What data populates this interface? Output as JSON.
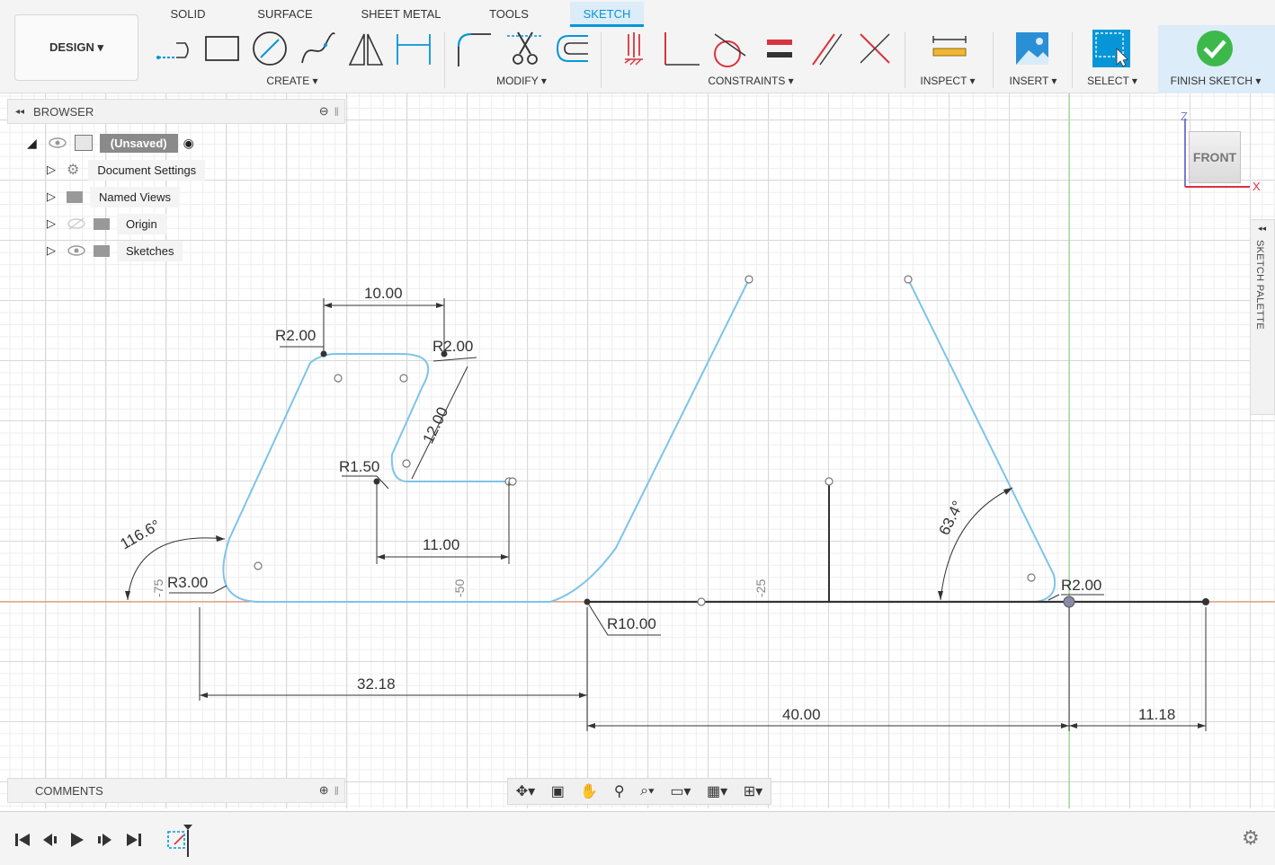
{
  "workspace": {
    "label": "DESIGN ▾"
  },
  "tabs": [
    "SOLID",
    "SURFACE",
    "SHEET METAL",
    "TOOLS",
    "SKETCH"
  ],
  "groups": {
    "create": "CREATE ▾",
    "modify": "MODIFY ▾",
    "constraints": "CONSTRAINTS ▾",
    "inspect": "INSPECT ▾",
    "insert": "INSERT ▾",
    "select": "SELECT ▾",
    "finish": "FINISH SKETCH ▾"
  },
  "colors": {
    "accent": "#0696d7",
    "profile_line": "#7ec3ea",
    "finish_check": "#3cb94a",
    "axis_red": "#e07a55",
    "axis_green": "#7fd67f"
  },
  "browser": {
    "title": "BROWSER",
    "root": "(Unsaved)",
    "items": [
      "Document Settings",
      "Named Views",
      "Origin",
      "Sketches"
    ]
  },
  "comments": {
    "title": "COMMENTS"
  },
  "viewcube": {
    "face": "FRONT",
    "z": "Z",
    "x": "X"
  },
  "sketch_palette": {
    "label": "SKETCH PALETTE"
  },
  "dimensions": {
    "top_width": "10.00",
    "r_top_left": "R2.00",
    "r_top_right": "R2.00",
    "slant": "12.00",
    "r_small": "R1.50",
    "inner_width": "11.00",
    "angle_left": "116.6°",
    "r_bottom_left": "R3.00",
    "r_bottom_mid": "R10.00",
    "r_right": "R2.00",
    "angle_right": "63.4°",
    "width_left": "32.18",
    "width_mid": "40.00",
    "width_right": "11.18"
  },
  "axis_ticks": [
    "-75",
    "-50",
    "-25"
  ],
  "icons": {
    "tools": [
      "line-icon",
      "rectangle-icon",
      "circle-icon",
      "spline-icon",
      "mirror-icon",
      "dimension-icon",
      "fillet-icon",
      "trim-icon",
      "offset-icon",
      "fix-icon",
      "perpendicular-icon",
      "tangent-icon",
      "equal-icon",
      "parallel-icon",
      "intersect-icon",
      "measure-icon",
      "image-icon",
      "select-icon",
      "finish-check-icon"
    ],
    "nav": [
      "orbit-icon",
      "look-at-icon",
      "pan-icon",
      "zoom-icon",
      "fit-icon",
      "display-icon",
      "grid-icon",
      "viewports-icon"
    ],
    "timeline": [
      "first-icon",
      "prev-icon",
      "play-icon",
      "next-icon",
      "last-icon",
      "sketch-feature-icon",
      "settings-icon"
    ]
  }
}
